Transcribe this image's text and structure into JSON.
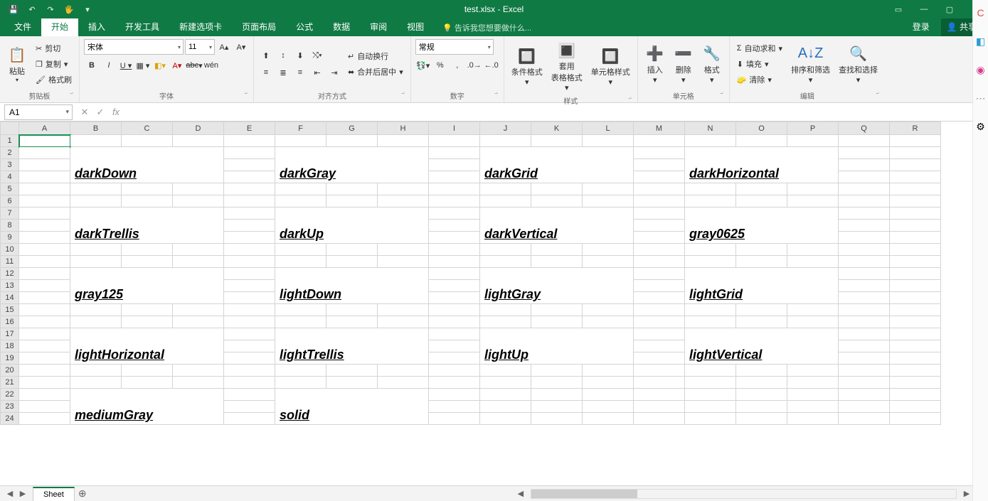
{
  "title": "test.xlsx - Excel",
  "qat": {
    "save": "💾",
    "undo": "↶",
    "redo": "↷",
    "touch": "🖐",
    "more": "▾"
  },
  "win": {
    "ribbonOpts": "▭",
    "min": "—",
    "restore": "▢",
    "close": "✕"
  },
  "tabs": {
    "file": "文件",
    "home": "开始",
    "insert": "插入",
    "dev": "开发工具",
    "newtab": "新建选项卡",
    "layout": "页面布局",
    "formula": "公式",
    "data": "数据",
    "review": "审阅",
    "view": "视图",
    "tellme": "告诉我您想要做什么...",
    "login": "登录",
    "share": "共享"
  },
  "ribbon": {
    "clipboard": {
      "paste": "粘贴",
      "cut": "剪切",
      "copy": "复制",
      "painter": "格式刷",
      "label": "剪贴板"
    },
    "font": {
      "name": "宋体",
      "size": "11",
      "label": "字体",
      "abc": "abc",
      "wen": "wén"
    },
    "align": {
      "wrap": "自动换行",
      "merge": "合并后居中",
      "label": "对齐方式"
    },
    "number": {
      "fmt": "常规",
      "label": "数字"
    },
    "styles": {
      "cond": "条件格式",
      "table": "套用\n表格格式",
      "cell": "单元格样式",
      "label": "样式"
    },
    "cells": {
      "insert": "插入",
      "delete": "删除",
      "format": "格式",
      "label": "单元格"
    },
    "editing": {
      "sum": "自动求和",
      "fill": "填充",
      "clear": "清除",
      "sort": "排序和筛选",
      "find": "查找和选择",
      "label": "编辑"
    }
  },
  "fbar": {
    "ref": "A1",
    "fx": "fx"
  },
  "cols": [
    "A",
    "B",
    "C",
    "D",
    "E",
    "F",
    "G",
    "H",
    "I",
    "J",
    "K",
    "L",
    "M",
    "N",
    "O",
    "P",
    "Q",
    "R"
  ],
  "rowCount": 24,
  "patterns": [
    {
      "row": 2,
      "col": 1,
      "label": "darkDown",
      "cls": "darkDown"
    },
    {
      "row": 2,
      "col": 5,
      "label": "darkGray",
      "cls": "darkGray"
    },
    {
      "row": 2,
      "col": 9,
      "label": "darkGrid",
      "cls": "darkGrid"
    },
    {
      "row": 2,
      "col": 13,
      "label": "darkHorizontal",
      "cls": "darkHorizontal"
    },
    {
      "row": 7,
      "col": 1,
      "label": "darkTrellis",
      "cls": "darkTrellis"
    },
    {
      "row": 7,
      "col": 5,
      "label": "darkUp",
      "cls": "darkUp"
    },
    {
      "row": 7,
      "col": 9,
      "label": "darkVertical",
      "cls": "darkVertical"
    },
    {
      "row": 7,
      "col": 13,
      "label": "gray0625",
      "cls": "gray0625"
    },
    {
      "row": 12,
      "col": 1,
      "label": "gray125",
      "cls": "gray125"
    },
    {
      "row": 12,
      "col": 5,
      "label": "lightDown",
      "cls": "lightDown"
    },
    {
      "row": 12,
      "col": 9,
      "label": "lightGray",
      "cls": "lightGray"
    },
    {
      "row": 12,
      "col": 13,
      "label": "lightGrid",
      "cls": "lightGrid"
    },
    {
      "row": 17,
      "col": 1,
      "label": "lightHorizontal",
      "cls": "lightHorizontal"
    },
    {
      "row": 17,
      "col": 5,
      "label": "lightTrellis",
      "cls": "lightTrellis"
    },
    {
      "row": 17,
      "col": 9,
      "label": "lightUp",
      "cls": "lightUp"
    },
    {
      "row": 17,
      "col": 13,
      "label": "lightVertical",
      "cls": "lightVertical"
    },
    {
      "row": 22,
      "col": 1,
      "label": "mediumGray",
      "cls": "mediumGray"
    },
    {
      "row": 22,
      "col": 5,
      "label": "solid",
      "cls": "solid"
    }
  ],
  "sheet": {
    "name": "Sheet"
  }
}
